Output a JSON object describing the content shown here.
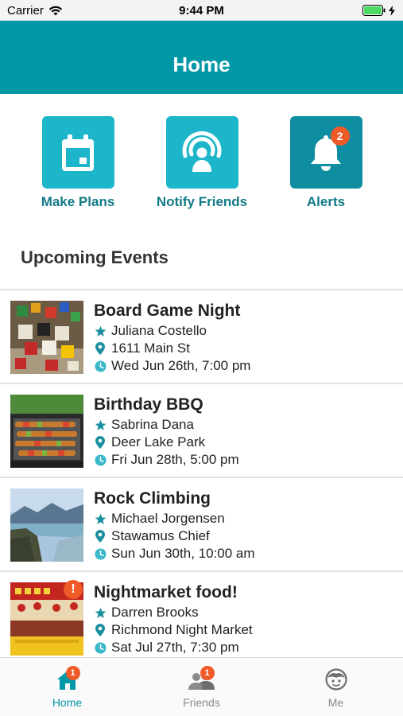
{
  "status_bar": {
    "carrier": "Carrier",
    "time": "9:44 PM"
  },
  "header": {
    "title": "Home"
  },
  "quick_actions": [
    {
      "label": "Make Plans",
      "icon": "calendar-icon",
      "color": "#1cb5c9"
    },
    {
      "label": "Notify Friends",
      "icon": "broadcast-person-icon",
      "color": "#1cb5c9"
    },
    {
      "label": "Alerts",
      "icon": "bell-icon",
      "color": "#0e8ea0",
      "badge": "2"
    }
  ],
  "section": {
    "title": "Upcoming Events"
  },
  "events": [
    {
      "title": "Board Game Night",
      "host": "Juliana Costello",
      "location": "1611 Main St",
      "time": "Wed Jun 26th, 7:00 pm"
    },
    {
      "title": "Birthday BBQ",
      "host": "Sabrina Dana",
      "location": "Deer Lake Park",
      "time": "Fri Jun 28th, 5:00 pm"
    },
    {
      "title": "Rock Climbing",
      "host": "Michael Jorgensen",
      "location": "Stawamus Chief",
      "time": "Sun Jun 30th, 10:00 am"
    },
    {
      "title": "Nightmarket food!",
      "host": "Darren Brooks",
      "location": "Richmond Night Market",
      "time": "Sat Jul 27th, 7:30 pm",
      "alert": "!"
    }
  ],
  "tabs": [
    {
      "label": "Home",
      "badge": "1",
      "active": true
    },
    {
      "label": "Friends",
      "badge": "1",
      "active": false
    },
    {
      "label": "Me",
      "active": false
    }
  ],
  "colors": {
    "accent": "#0097a7",
    "tile": "#1cb5c9",
    "tile_dark": "#0e8ea0",
    "badge": "#f05a28",
    "label": "#127a86",
    "icon": "#1a8fa0",
    "tab_inactive": "#8a8a8a"
  }
}
